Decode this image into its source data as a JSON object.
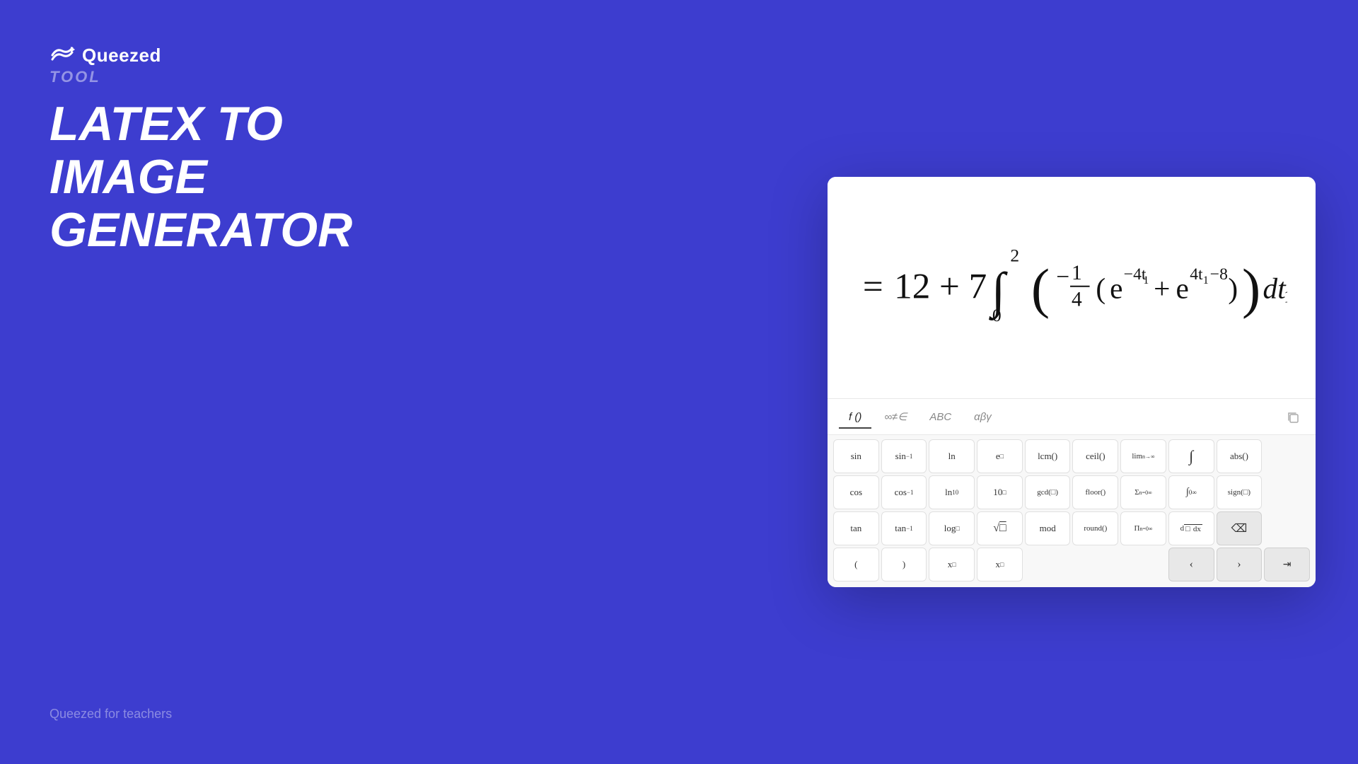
{
  "logo": {
    "text": "Queezed"
  },
  "left": {
    "tool_label": "TOOL",
    "main_title_line1": "LATEX TO IMAGE",
    "main_title_line2": "GENERATOR",
    "footer": "Queezed for teachers"
  },
  "tabs": [
    {
      "id": "f",
      "label": "f ()",
      "active": true
    },
    {
      "id": "symbols",
      "label": "∞≠∈",
      "active": false
    },
    {
      "id": "abc",
      "label": "ABC",
      "active": false
    },
    {
      "id": "greek",
      "label": "αβγ",
      "active": false
    }
  ],
  "buttons": [
    {
      "row": 1,
      "label": "sin",
      "type": "normal"
    },
    {
      "row": 1,
      "label": "sin⁻¹",
      "type": "normal"
    },
    {
      "row": 1,
      "label": "ln",
      "type": "normal"
    },
    {
      "row": 1,
      "label": "e□",
      "type": "normal"
    },
    {
      "row": 1,
      "label": "lcm()",
      "type": "normal"
    },
    {
      "row": 1,
      "label": "ceil()",
      "type": "normal"
    },
    {
      "row": 1,
      "label": "lim",
      "type": "normal"
    },
    {
      "row": 1,
      "label": "∫",
      "type": "normal"
    },
    {
      "row": 1,
      "label": "abs()",
      "type": "normal"
    },
    {
      "row": 2,
      "label": "cos",
      "type": "normal"
    },
    {
      "row": 2,
      "label": "cos⁻¹",
      "type": "normal"
    },
    {
      "row": 2,
      "label": "ln₁₀",
      "type": "normal"
    },
    {
      "row": 2,
      "label": "10□",
      "type": "normal"
    },
    {
      "row": 2,
      "label": "gcd(□)",
      "type": "normal"
    },
    {
      "row": 2,
      "label": "floor()",
      "type": "normal"
    },
    {
      "row": 2,
      "label": "Σ",
      "type": "normal"
    },
    {
      "row": 2,
      "label": "∫₀∞",
      "type": "normal"
    },
    {
      "row": 2,
      "label": "sign(□)",
      "type": "normal"
    },
    {
      "row": 3,
      "label": "tan",
      "type": "normal"
    },
    {
      "row": 3,
      "label": "tan⁻¹",
      "type": "normal"
    },
    {
      "row": 3,
      "label": "log□",
      "type": "normal"
    },
    {
      "row": 3,
      "label": "√□",
      "type": "normal"
    },
    {
      "row": 3,
      "label": "mod",
      "type": "normal"
    },
    {
      "row": 3,
      "label": "round()",
      "type": "normal"
    },
    {
      "row": 3,
      "label": "Π",
      "type": "normal"
    },
    {
      "row": 3,
      "label": "d/dx",
      "type": "normal"
    },
    {
      "row": 3,
      "label": "⌫",
      "type": "gray"
    },
    {
      "row": 4,
      "label": "(",
      "type": "normal"
    },
    {
      "row": 4,
      "label": ")",
      "type": "normal"
    },
    {
      "row": 4,
      "label": "x□",
      "type": "normal"
    },
    {
      "row": 4,
      "label": "x□",
      "type": "normal"
    },
    {
      "row": 4,
      "label": "",
      "type": "empty"
    },
    {
      "row": 4,
      "label": "",
      "type": "empty"
    },
    {
      "row": 4,
      "label": "‹",
      "type": "gray"
    },
    {
      "row": 4,
      "label": "›",
      "type": "gray"
    },
    {
      "row": 4,
      "label": "⇥",
      "type": "gray"
    }
  ]
}
